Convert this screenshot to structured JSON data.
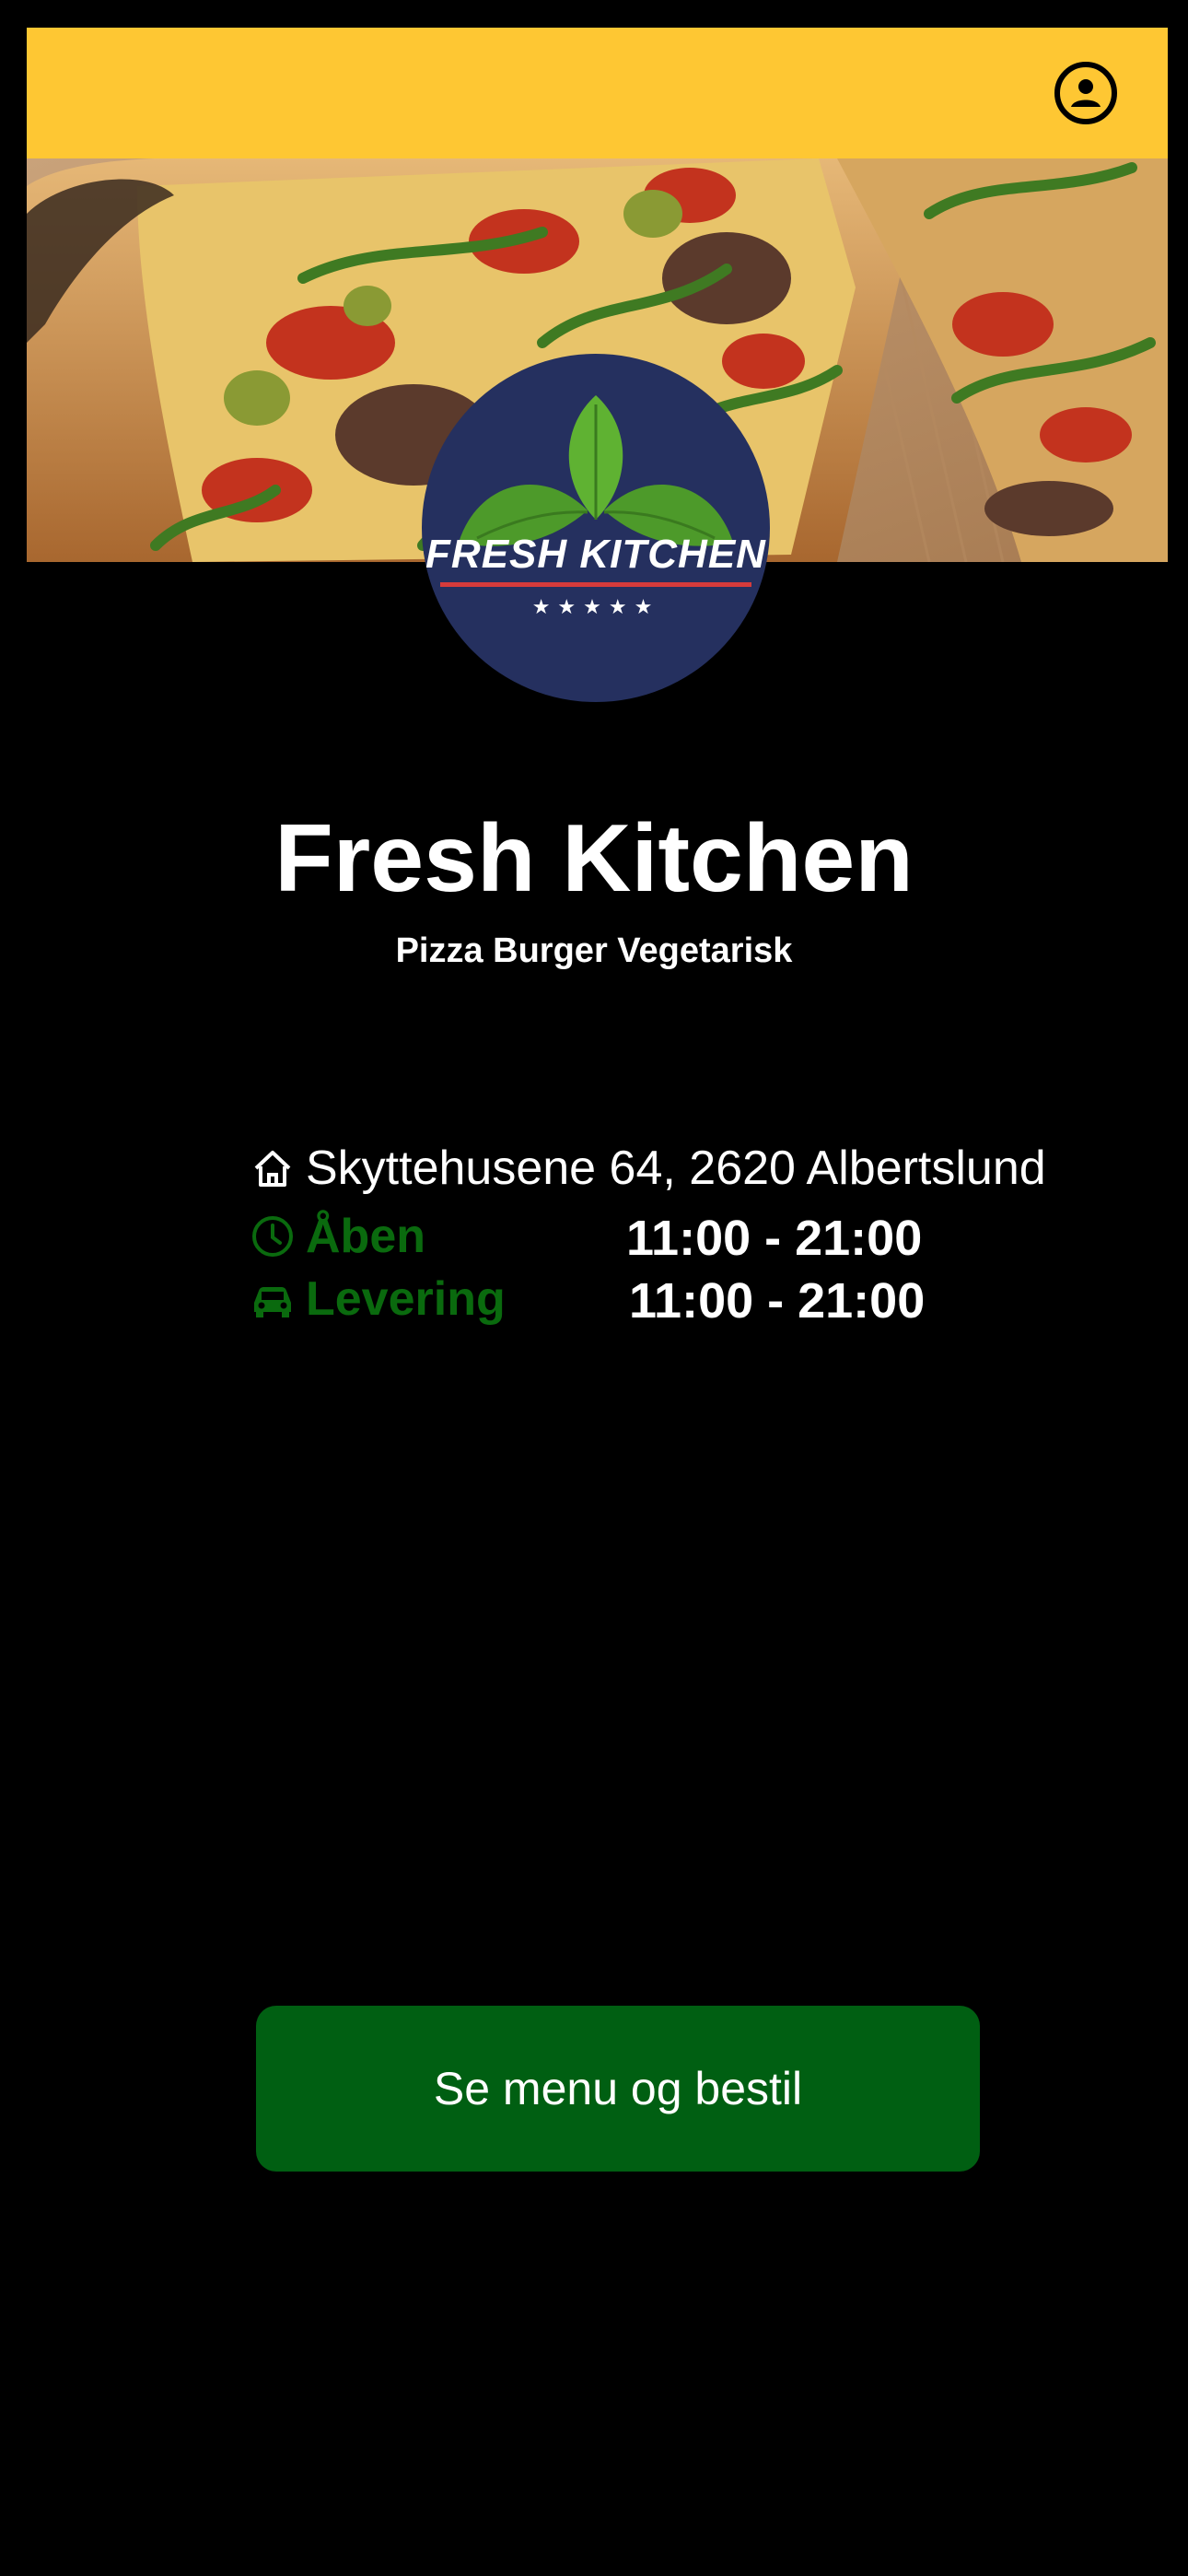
{
  "header": {
    "profile_icon": "user-circle-icon",
    "background_color": "#FEC733"
  },
  "hero": {
    "image": "pizza-photo"
  },
  "logo": {
    "text": "FRESH KITCHEN",
    "stars": "★★★★★",
    "background_color": "#25305F"
  },
  "restaurant": {
    "name": "Fresh Kitchen",
    "tags": "Pizza Burger Vegetarisk",
    "address": "Skyttehusene 64, 2620 Albertslund",
    "address_icon": "home-icon",
    "open_label": "Åben",
    "open_icon": "clock-icon",
    "open_hours": "11:00 - 21:00",
    "delivery_label": "Levering",
    "delivery_icon": "car-icon",
    "delivery_hours": "11:00 - 21:00",
    "label_color": "#0A6A0E"
  },
  "cta": {
    "label": "Se menu og bestil",
    "color": "#005F12"
  }
}
